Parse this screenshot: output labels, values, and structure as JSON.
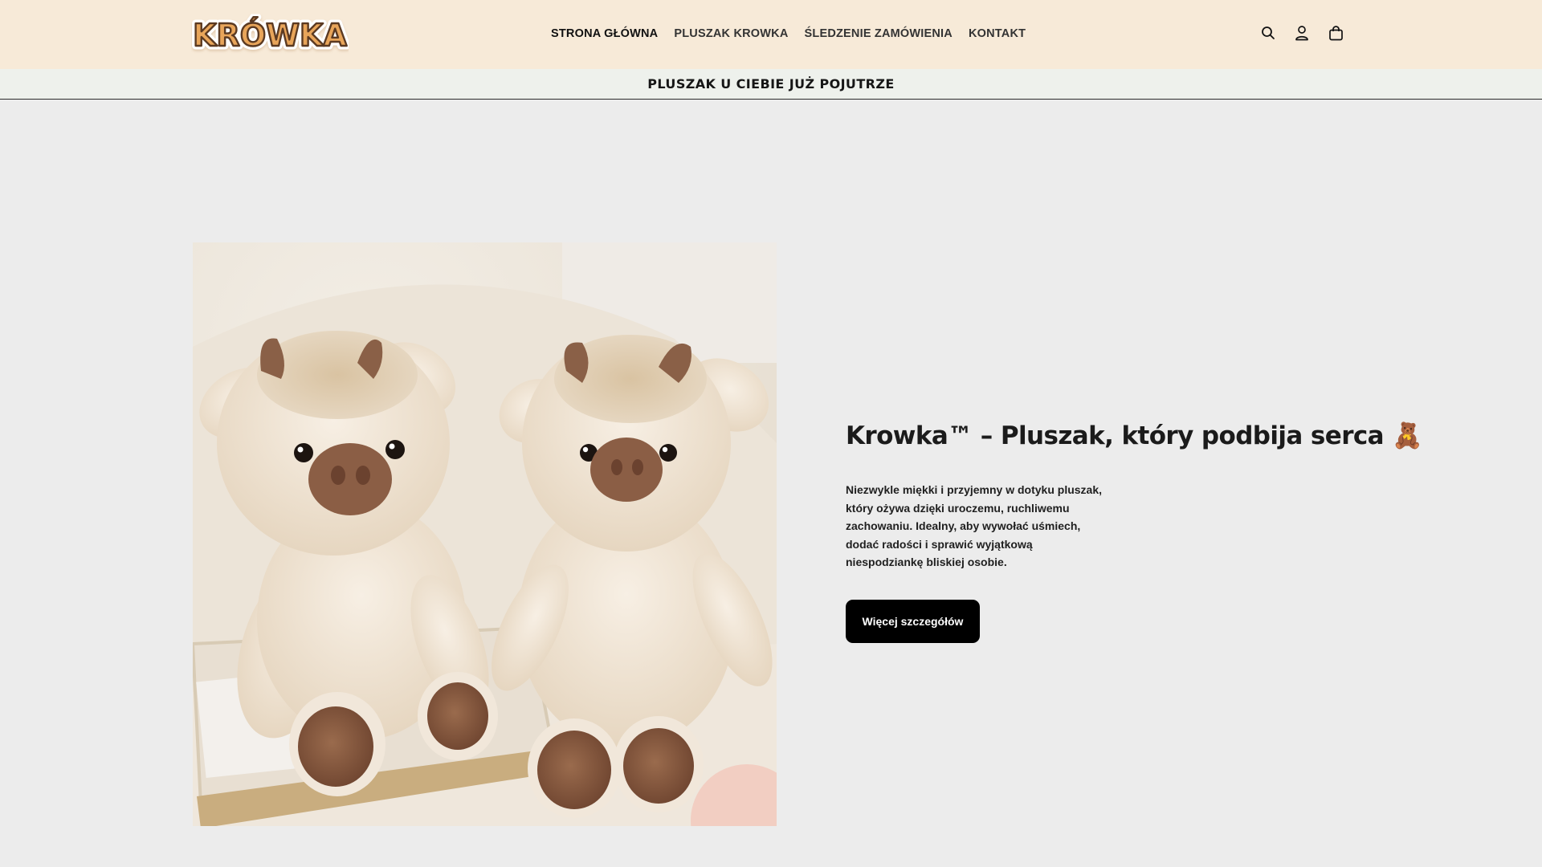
{
  "header": {
    "logo_text": "KRÓWKA",
    "nav": [
      {
        "label": "STRONA GŁÓWNA"
      },
      {
        "label": "PLUSZAK KROWKA"
      },
      {
        "label": "ŚLEDZENIE ZAMÓWIENIA"
      },
      {
        "label": "KONTAKT"
      }
    ],
    "icons": [
      "search-icon",
      "account-icon",
      "cart-icon"
    ]
  },
  "announcement": {
    "text": "PLUSZAK U CIEBIE JUŻ POJUTRZE"
  },
  "hero": {
    "title": "Krowka™ – Pluszak, który podbija serca 🧸",
    "description": "Niezwykle miękki i przyjemny w dotyku pluszak, który ożywa dzięki uroczemu, ruchliwemu zachowaniu. Idealny, aby wywołać uśmiech, dodać radości i sprawić wyjątkową niespodziankę bliskiej osobie.",
    "button_label": "Więcej szczegółów",
    "image_alt": "two cream-colored cow plush toys"
  },
  "colors": {
    "header_bg": "#f7ead8",
    "announce_bg": "#eef1ec",
    "page_bg": "#ececec",
    "button_bg": "#000000",
    "logo_fill": "#e8a55a",
    "logo_outline": "#5b3a22"
  }
}
